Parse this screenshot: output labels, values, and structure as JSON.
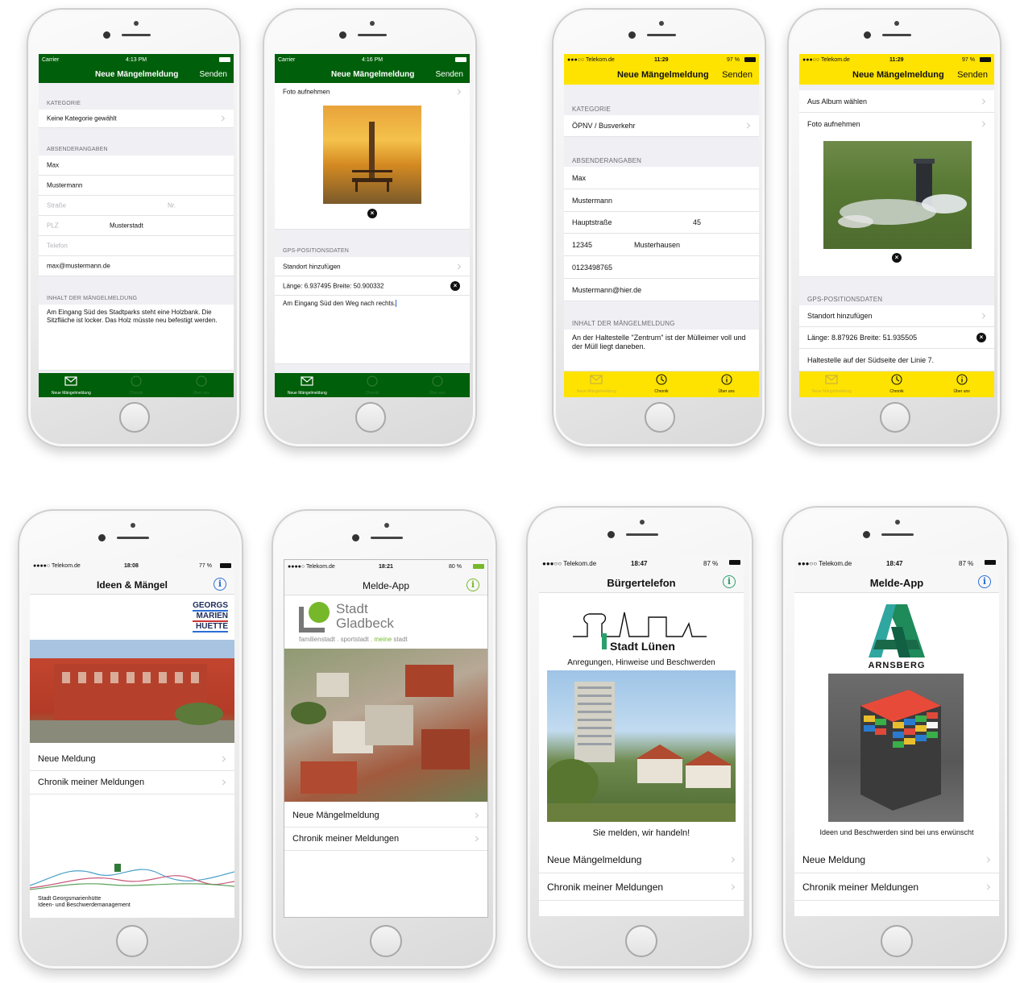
{
  "colors": {
    "green_bar": "#005f0a",
    "yellow_bar": "#ffe300",
    "link_blue": "#2a6fd6",
    "gladbeck_green": "#77b82a"
  },
  "phone1": {
    "status": {
      "carrier": "Carrier",
      "time": "4:13 PM"
    },
    "nav": {
      "title": "Neue Mängelmeldung",
      "action": "Senden"
    },
    "category_header": "KATEGORIE",
    "category_value": "Keine Kategorie gewählt",
    "sender_header": "ABSENDERANGABEN",
    "first_name": "Max",
    "last_name": "Mustermann",
    "street_placeholder": "Straße",
    "number_placeholder": "Nr.",
    "zip_placeholder": "PLZ",
    "city": "Musterstadt",
    "phone_placeholder": "Telefon",
    "email": "max@mustermann.de",
    "content_header": "INHALT DER MÄNGELMELDUNG",
    "content_text": "Am Eingang Süd des Stadtparks steht eine Holzbank. Die Sitzfläche ist locker. Das Holz müsste neu befestigt werden.",
    "tabs": [
      "Neue Mängelmeldung",
      "Chronik",
      "Über uns"
    ]
  },
  "phone2": {
    "status": {
      "carrier": "Carrier",
      "time": "4:16 PM"
    },
    "nav": {
      "title": "Neue Mängelmeldung",
      "action": "Senden"
    },
    "take_photo": "Foto aufnehmen",
    "gps_header": "GPS-POSITIONSDATEN",
    "add_location": "Standort hinzufügen",
    "coordinates": "Länge: 6.937495 Breite: 50.900332",
    "note": "Am Eingang Süd den Weg nach rechts.",
    "tabs": [
      "Neue Mängelmeldung",
      "Chronik",
      "Über uns"
    ]
  },
  "phone3": {
    "status": {
      "carrier": "●●●○○ Telekom.de",
      "time": "11:29",
      "battery": "97 %"
    },
    "nav": {
      "title": "Neue Mängelmeldung",
      "action": "Senden"
    },
    "category_header": "KATEGORIE",
    "category_value": "ÖPNV / Busverkehr",
    "sender_header": "ABSENDERANGABEN",
    "first_name": "Max",
    "last_name": "Mustermann",
    "street": "Hauptstraße",
    "number": "45",
    "zip": "12345",
    "city": "Musterhausen",
    "phone": "0123498765",
    "email": "Mustermann@hier.de",
    "content_header": "INHALT DER MÄNGELMELDUNG",
    "content_text": "An der Haltestelle \"Zentrum\" ist der Mülleimer voll und der Müll liegt daneben.",
    "tabs": [
      "Neue Mängelmeldung",
      "Chronik",
      "Über uns"
    ]
  },
  "phone4": {
    "status": {
      "carrier": "●●●○○ Telekom.de",
      "time": "11:29",
      "battery": "97 %"
    },
    "nav": {
      "title": "Neue Mängelmeldung",
      "action": "Senden"
    },
    "choose_album": "Aus Album wählen",
    "take_photo": "Foto aufnehmen",
    "gps_header": "GPS-POSITIONSDATEN",
    "add_location": "Standort hinzufügen",
    "coordinates": "Länge: 8.87926 Breite: 51.935505",
    "note": "Haltestelle auf der Südseite der Linie 7.",
    "tabs": [
      "Neue Mängelmeldung",
      "Chronik",
      "Über uns"
    ]
  },
  "phone5": {
    "status": {
      "carrier": "●●●●○ Telekom.de",
      "time": "18:08",
      "battery": "77 %"
    },
    "nav_title": "Ideen & Mängel",
    "logo_lines": [
      "GEORGS",
      "MARIEN",
      "HUETTE"
    ],
    "menu": [
      "Neue Meldung",
      "Chronik meiner Meldungen"
    ],
    "footer_lines": [
      "Stadt Georgsmarienhütte",
      "Ideen- und Beschwerdemanagement"
    ]
  },
  "phone6": {
    "status": {
      "carrier": "●●●●○ Telekom.de",
      "time": "18:21",
      "battery": "80 %"
    },
    "nav_title": "Melde-App",
    "logo_line1": "Stadt",
    "logo_line2": "Gladbeck",
    "logo_tag_a": "familienstadt . sportstadt . ",
    "logo_tag_b": "meine",
    "logo_tag_c": " stadt",
    "menu": [
      "Neue Mängelmeldung",
      "Chronik meiner Meldungen"
    ]
  },
  "phone7": {
    "status": {
      "carrier": "●●●○○ Telekom.de",
      "time": "18:47",
      "battery": "87 %"
    },
    "nav_title": "Bürgertelefon",
    "logo_text": "Stadt Lünen",
    "subtitle": "Anregungen, Hinweise und Beschwerden",
    "slogan": "Sie melden, wir handeln!",
    "menu": [
      "Neue Mängelmeldung",
      "Chronik meiner Meldungen"
    ]
  },
  "phone8": {
    "status": {
      "carrier": "●●●○○ Telekom.de",
      "time": "18:47",
      "battery": "87 %"
    },
    "nav_title": "Melde-App",
    "logo_text": "ARNSBERG",
    "caption": "Ideen und Beschwerden sind bei uns erwünscht",
    "menu": [
      "Neue Meldung",
      "Chronik meiner Meldungen"
    ]
  }
}
